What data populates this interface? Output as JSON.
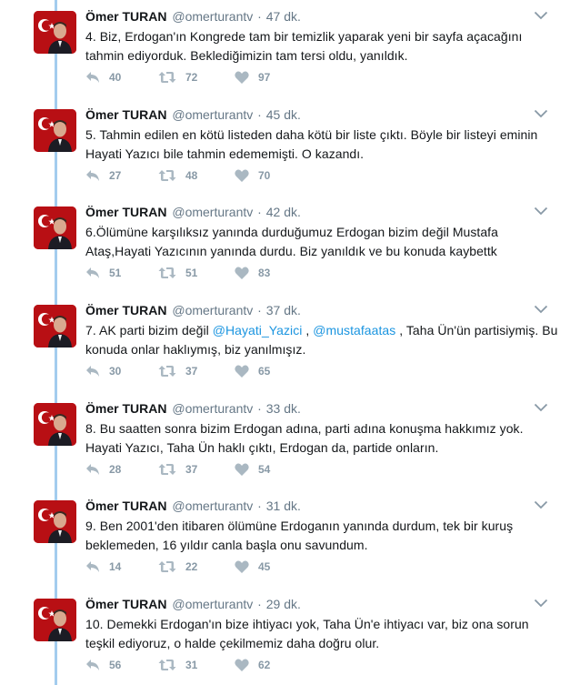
{
  "tweets": [
    {
      "fullname": "Ömer TURAN",
      "username": "@omerturantv",
      "sep": "·",
      "time": "47 dk.",
      "text": "4. Biz, Erdogan'ın Kongrede tam bir temizlik yaparak yeni bir sayfa açacağını tahmin ediyorduk. Beklediğimizin tam tersi oldu, yanıldık.",
      "replies": "40",
      "retweets": "72",
      "likes": "97"
    },
    {
      "fullname": "Ömer TURAN",
      "username": "@omerturantv",
      "sep": "·",
      "time": "45 dk.",
      "text": "5. Tahmin edilen en kötü listeden daha kötü bir liste çıktı. Böyle bir listeyi eminin Hayati Yazıcı bile tahmin edememişti. O kazandı.",
      "replies": "27",
      "retweets": "48",
      "likes": "70"
    },
    {
      "fullname": "Ömer TURAN",
      "username": "@omerturantv",
      "sep": "·",
      "time": "42 dk.",
      "text": "6.Ölümüne karşılıksız yanında durduğumuz Erdogan bizim değil Mustafa Ataş,Hayati Yazıcının yanında durdu. Biz yanıldık ve bu konuda kaybettk",
      "replies": "51",
      "retweets": "51",
      "likes": "83"
    },
    {
      "fullname": "Ömer TURAN",
      "username": "@omerturantv",
      "sep": "·",
      "time": "37 dk.",
      "text_a": "7. AK parti bizim değil ",
      "mention_1": "@Hayati_Yazici",
      "text_b": " , ",
      "mention_2": "@mustafaatas",
      "text_c": " , Taha Ün'ün partisiymiş. Bu konuda onlar haklıymış, biz yanılmışız.",
      "replies": "30",
      "retweets": "37",
      "likes": "65"
    },
    {
      "fullname": "Ömer TURAN",
      "username": "@omerturantv",
      "sep": "·",
      "time": "33 dk.",
      "text": "8. Bu saatten sonra bizim Erdogan adına, parti adına konuşma hakkımız yok. Hayati Yazıcı, Taha Ün haklı çıktı, Erdogan da, partide onların.",
      "replies": "28",
      "retweets": "37",
      "likes": "54"
    },
    {
      "fullname": "Ömer TURAN",
      "username": "@omerturantv",
      "sep": "·",
      "time": "31 dk.",
      "text": "9. Ben 2001'den itibaren ölümüne Erdoganın yanında durdum, tek bir kuruş beklemeden, 16 yıldır canla başla onu savundum.",
      "replies": "14",
      "retweets": "22",
      "likes": "45"
    },
    {
      "fullname": "Ömer TURAN",
      "username": "@omerturantv",
      "sep": "·",
      "time": "29 dk.",
      "text": "10. Demekki Erdogan'ın bize ihtiyacı yok, Taha Ün'e ihtiyacı var, biz ona sorun teşkil ediyoruz, o halde çekilmemiz daha doğru olur.",
      "replies": "56",
      "retweets": "31",
      "likes": "62"
    }
  ],
  "icons": {
    "reply": "reply-icon",
    "retweet": "retweet-icon",
    "like": "heart-icon",
    "more": "chevron-down-icon",
    "avatar": "avatar"
  },
  "colors": {
    "thread_line": "#a3ccee",
    "mention": "#1b95e0",
    "meta": "#657786",
    "action": "#aab8c2",
    "avatar_bg": "#b80f14"
  }
}
